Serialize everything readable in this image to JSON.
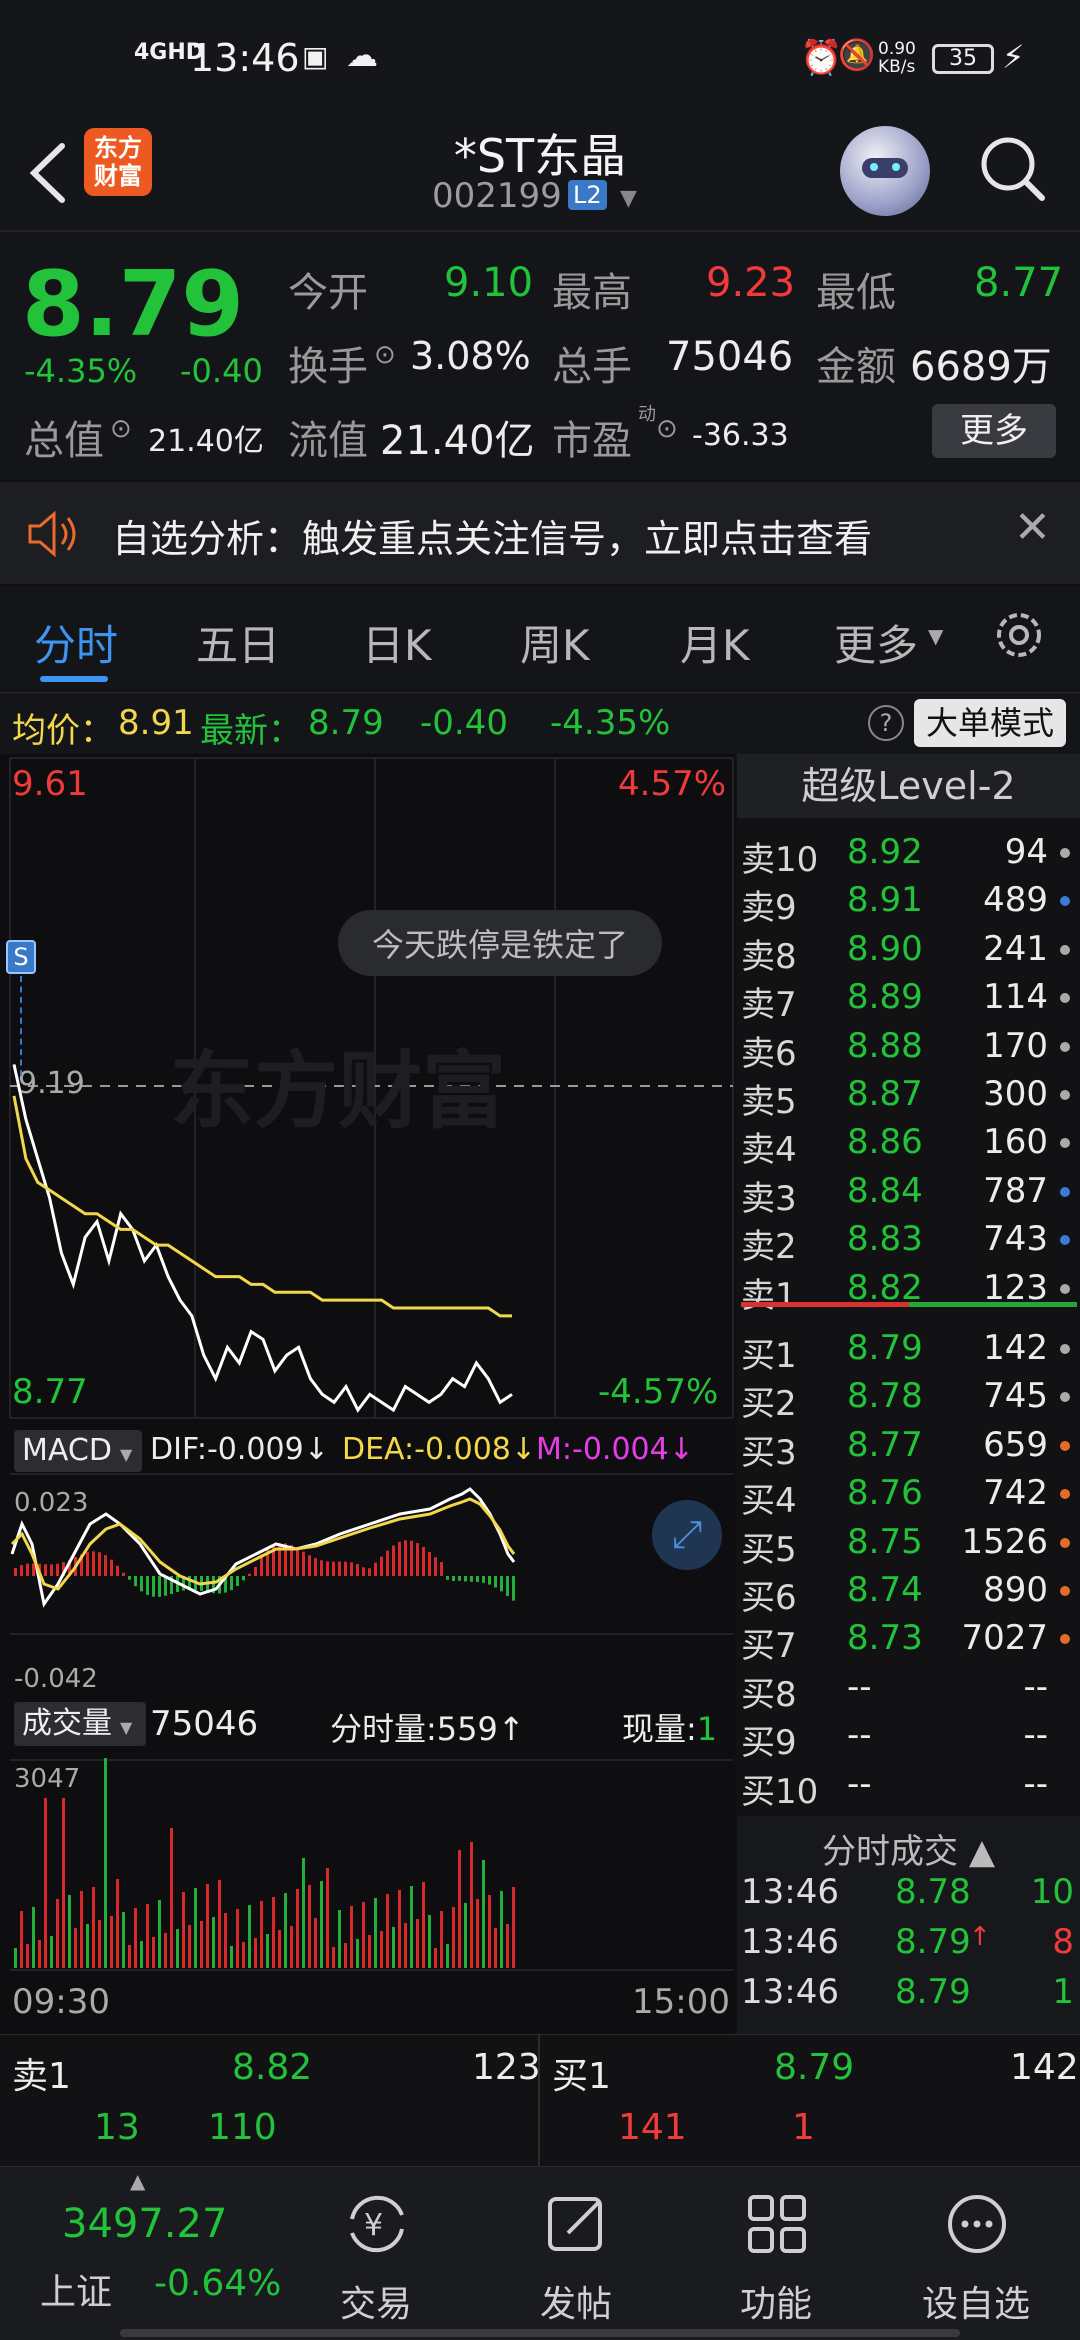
{
  "status_bar": {
    "network": "4GHD",
    "time": "13:46",
    "speed": "0.90\nKB/s",
    "battery": "35"
  },
  "header": {
    "back_icon": "back-arrow-icon",
    "logo": "东方\n财富",
    "title": "*ST东晶",
    "code": "002199",
    "level_badge": "L2"
  },
  "quote": {
    "price": "8.79",
    "change_pct": "-4.35%",
    "change": "-0.40",
    "open_label": "今开",
    "open": "9.10",
    "high_label": "最高",
    "high": "9.23",
    "low_label": "最低",
    "low": "8.77",
    "turnover_label": "换手",
    "turnover": "3.08%",
    "volume_label": "总手",
    "volume": "75046",
    "amount_label": "金额",
    "amount": "6689万",
    "mktcap_label": "总值",
    "mktcap": "21.40亿",
    "float_label": "流值",
    "float": "21.40亿",
    "pe_label": "市盈",
    "pe_sup": "动",
    "pe": "-36.33",
    "more_button": "更多"
  },
  "notice": {
    "text": "自选分析：触发重点关注信号，立即点击查看"
  },
  "tabs": {
    "items": [
      "分时",
      "五日",
      "日K",
      "周K",
      "月K",
      "更多"
    ],
    "active": 0
  },
  "infobar": {
    "avg_label": "均价：",
    "avg": "8.91",
    "latest_label": "最新：",
    "latest": "8.79",
    "change": "-0.40",
    "change_pct": "-4.35%",
    "mode_button": "大单模式"
  },
  "chart": {
    "top_price": "9.61",
    "top_pct": "4.57%",
    "bottom_price": "8.77",
    "bottom_pct": "-4.57%",
    "preclose": "9.19",
    "bubble": "今天跌停是铁定了",
    "watermark": "东方财富",
    "s_marker": "S",
    "macd_label": "MACD",
    "dif": "DIF:-0.009",
    "dea": "DEA:-0.008",
    "m": "M:-0.004",
    "macd_top": "0.023",
    "macd_bottom": "-0.042",
    "vol_label": "成交量",
    "vol_total": "75046",
    "fen_label": "分时量:",
    "fen_value": "559",
    "now_label": "现量:",
    "now_value": "1",
    "vol_max": "3047",
    "time_start": "09:30",
    "time_end": "15:00"
  },
  "chart_data": {
    "type": "line",
    "price_range": [
      8.77,
      9.61
    ],
    "preclose": 9.19,
    "series": [
      {
        "name": "price",
        "values": [
          9.22,
          9.15,
          9.1,
          9.05,
          8.98,
          8.94,
          9.0,
          9.02,
          8.97,
          9.03,
          9.01,
          8.97,
          8.99,
          8.95,
          8.92,
          8.9,
          8.85,
          8.82,
          8.86,
          8.84,
          8.88,
          8.87,
          8.83,
          8.85,
          8.86,
          8.82,
          8.8,
          8.79,
          8.81,
          8.78,
          8.8,
          8.79,
          8.78,
          8.81,
          8.8,
          8.79,
          8.8,
          8.82,
          8.81,
          8.84,
          8.82,
          8.79,
          8.8
        ]
      },
      {
        "name": "avg",
        "values": [
          9.18,
          9.1,
          9.07,
          9.06,
          9.05,
          9.04,
          9.03,
          9.03,
          9.02,
          9.01,
          9.01,
          9.0,
          8.99,
          8.99,
          8.98,
          8.97,
          8.96,
          8.95,
          8.95,
          8.95,
          8.94,
          8.94,
          8.93,
          8.93,
          8.93,
          8.93,
          8.92,
          8.92,
          8.92,
          8.92,
          8.92,
          8.92,
          8.91,
          8.91,
          8.91,
          8.91,
          8.91,
          8.91,
          8.91,
          8.91,
          8.91,
          8.9,
          8.9
        ]
      }
    ]
  },
  "orderbook": {
    "title": "超级Level-2",
    "asks": [
      {
        "label": "卖10",
        "price": "8.92",
        "vol": "94",
        "dot": "#aaaaaa"
      },
      {
        "label": "卖9",
        "price": "8.91",
        "vol": "489",
        "dot": "#3a7bd5"
      },
      {
        "label": "卖8",
        "price": "8.90",
        "vol": "241",
        "dot": "#aaaaaa"
      },
      {
        "label": "卖7",
        "price": "8.89",
        "vol": "114",
        "dot": "#aaaaaa"
      },
      {
        "label": "卖6",
        "price": "8.88",
        "vol": "170",
        "dot": "#aaaaaa"
      },
      {
        "label": "卖5",
        "price": "8.87",
        "vol": "300",
        "dot": "#aaaaaa"
      },
      {
        "label": "卖4",
        "price": "8.86",
        "vol": "160",
        "dot": "#aaaaaa"
      },
      {
        "label": "卖3",
        "price": "8.84",
        "vol": "787",
        "dot": "#3a7bd5"
      },
      {
        "label": "卖2",
        "price": "8.83",
        "vol": "743",
        "dot": "#3a7bd5"
      },
      {
        "label": "卖1",
        "price": "8.82",
        "vol": "123",
        "dot": "#aaaaaa"
      }
    ],
    "bids": [
      {
        "label": "买1",
        "price": "8.79",
        "vol": "142",
        "dot": "#aaaaaa"
      },
      {
        "label": "买2",
        "price": "8.78",
        "vol": "745",
        "dot": "#aaaaaa"
      },
      {
        "label": "买3",
        "price": "8.77",
        "vol": "659",
        "dot": "#e86a2a"
      },
      {
        "label": "买4",
        "price": "8.76",
        "vol": "742",
        "dot": "#e86a2a"
      },
      {
        "label": "买5",
        "price": "8.75",
        "vol": "1526",
        "dot": "#e86a2a"
      },
      {
        "label": "买6",
        "price": "8.74",
        "vol": "890",
        "dot": "#e86a2a"
      },
      {
        "label": "买7",
        "price": "8.73",
        "vol": "7027",
        "dot": "#e86a2a"
      },
      {
        "label": "买8",
        "price": "--",
        "vol": "--",
        "dot": "#aaaaaa"
      },
      {
        "label": "买9",
        "price": "--",
        "vol": "--",
        "dot": "#aaaaaa"
      },
      {
        "label": "买10",
        "price": "--",
        "vol": "--",
        "dot": "#aaaaaa"
      }
    ],
    "ticks_title": "分时成交",
    "ticks": [
      {
        "time": "13:46",
        "price": "8.78",
        "vol": "10"
      },
      {
        "time": "13:46",
        "price": "8.79",
        "vol": "8"
      },
      {
        "time": "13:46",
        "price": "8.79",
        "vol": "1"
      }
    ]
  },
  "bottom_quote": {
    "ask_label": "卖1",
    "ask_price": "8.82",
    "ask_vol": "123",
    "ask_a": "13",
    "ask_b": "110",
    "bid_label": "买1",
    "bid_price": "8.79",
    "bid_vol": "142",
    "bid_a": "141",
    "bid_b": "1"
  },
  "nav": {
    "index_value": "3497.27",
    "index_name": "上证",
    "index_change": "-0.64%",
    "items": [
      {
        "label": "交易",
        "icon": "yen-refresh-icon"
      },
      {
        "label": "发帖",
        "icon": "edit-icon"
      },
      {
        "label": "功能",
        "icon": "grid-icon"
      },
      {
        "label": "设自选",
        "icon": "more-dots-icon"
      }
    ]
  },
  "colors": {
    "up": "#f23a3a",
    "down": "#22c33a",
    "avg_line": "#f2d64b",
    "accent": "#3a8ee6"
  }
}
